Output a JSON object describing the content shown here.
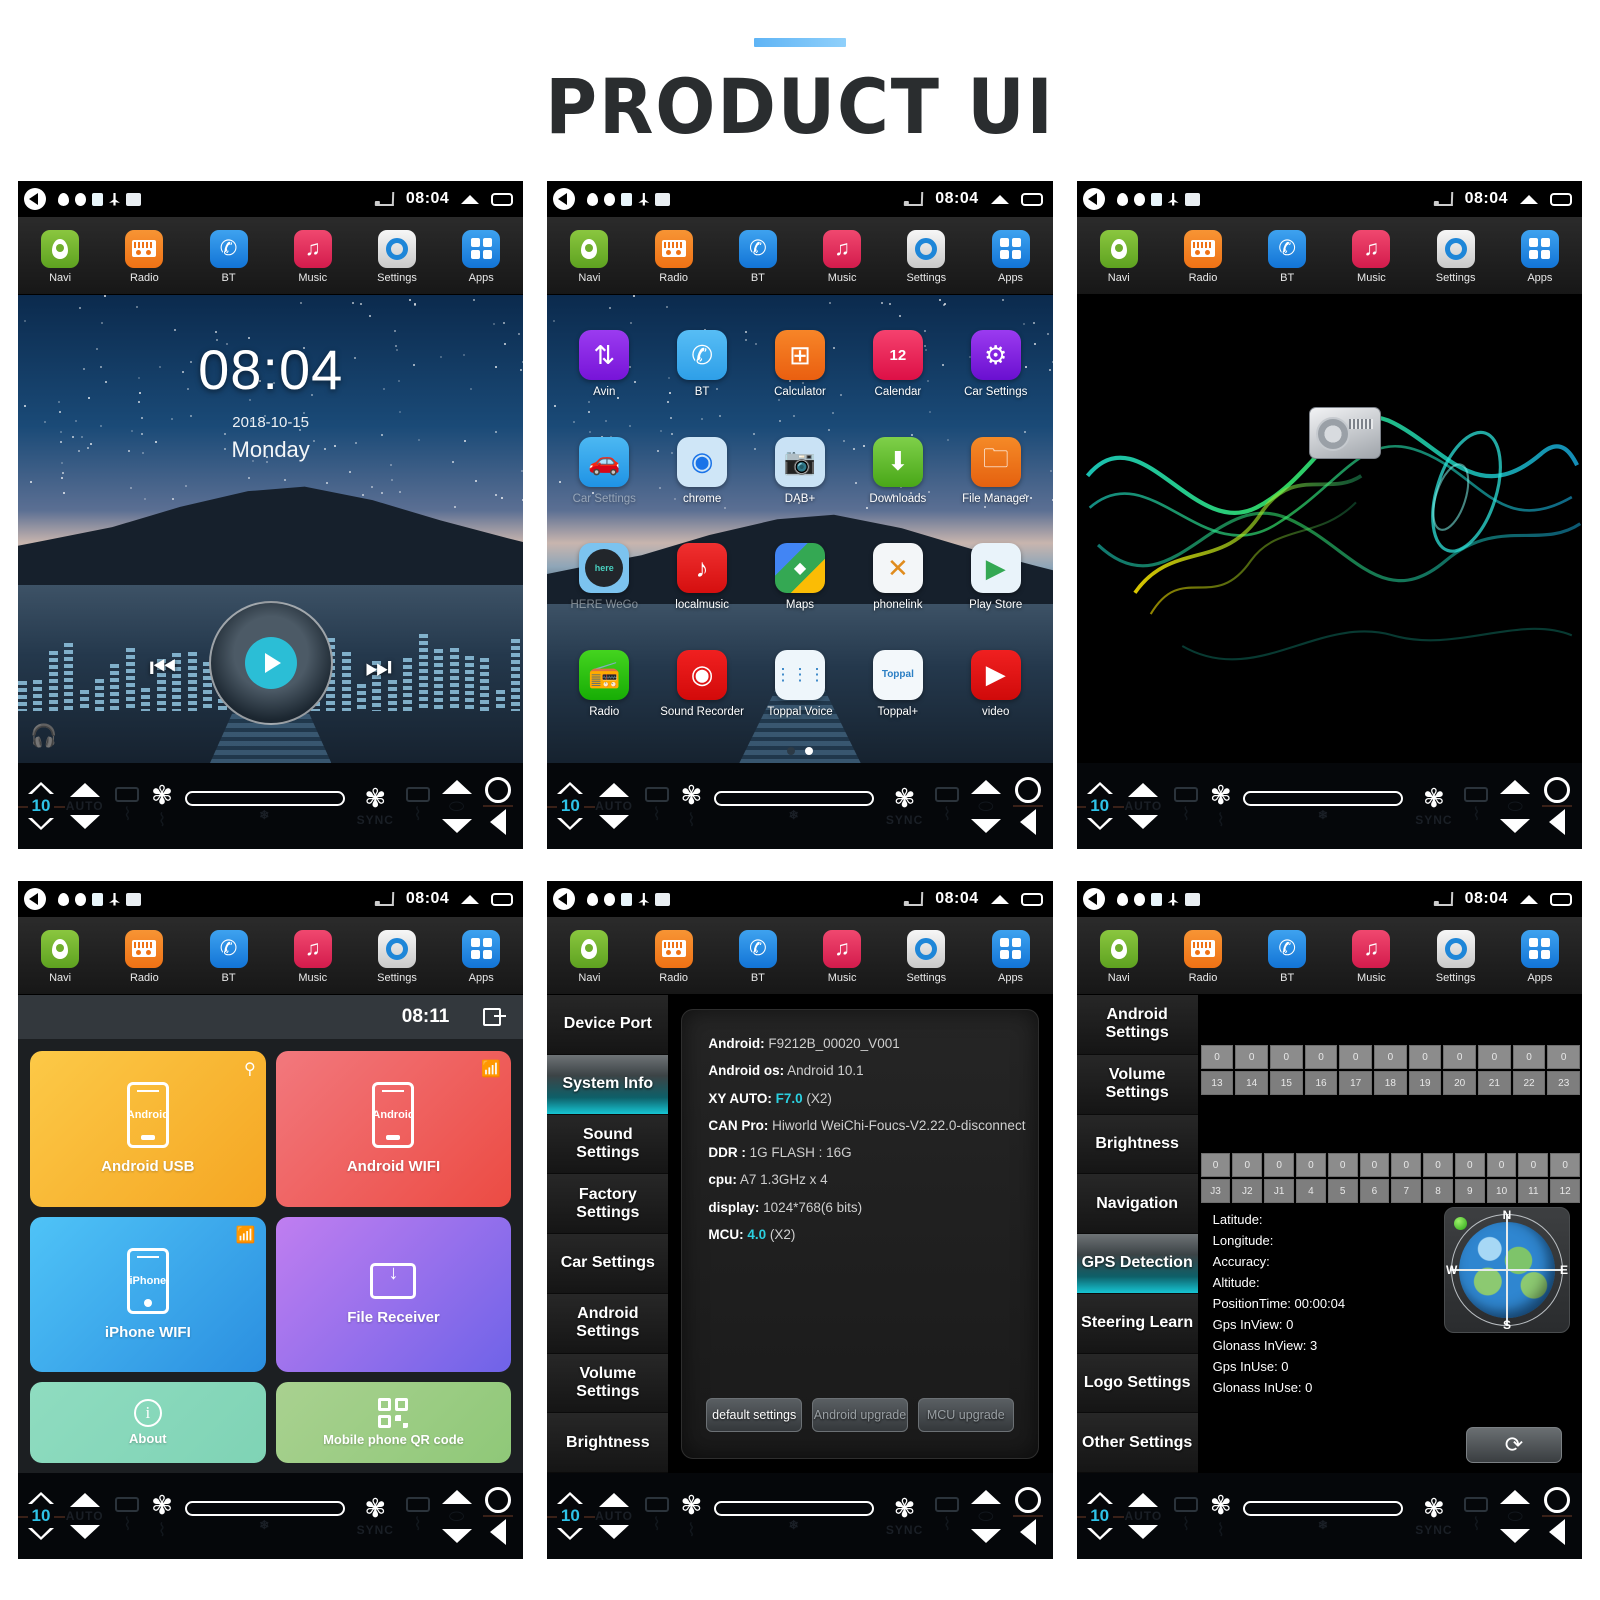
{
  "header": {
    "title": "PRODUCT UI",
    "accent_color": "#5fb4f5"
  },
  "statusbar": {
    "time": "08:04",
    "icons": [
      "back-icon",
      "location-pin-icon",
      "droplet-icon",
      "badge-icon",
      "bluetooth-icon",
      "card-icon",
      "cast-icon",
      "chevron-up-icon",
      "window-icon"
    ]
  },
  "navbar": {
    "items": [
      {
        "label": "Navi",
        "icon": "location-pin-icon",
        "color": "#6fae2c"
      },
      {
        "label": "Radio",
        "icon": "radio-icon",
        "color": "#ef7215"
      },
      {
        "label": "BT",
        "icon": "phone-icon",
        "color": "#1274d6"
      },
      {
        "label": "Music",
        "icon": "music-note-icon",
        "color": "#d31b4c"
      },
      {
        "label": "Settings",
        "icon": "gear-icon",
        "color": "#e6e6e6"
      },
      {
        "label": "Apps",
        "icon": "grid-icon",
        "color": "#1274d6"
      }
    ]
  },
  "home": {
    "clock": "08:04",
    "date": "2018-10-15",
    "weekday": "Monday",
    "prev_icon": "rewind-icon",
    "next_icon": "fast-forward-icon",
    "play_icon": "play-icon",
    "headphone_icon": "headphone-icon"
  },
  "apps": {
    "items": [
      {
        "label": "Avin",
        "dim": false
      },
      {
        "label": "BT",
        "dim": false
      },
      {
        "label": "Calculator",
        "dim": false
      },
      {
        "label": "Calendar",
        "dim": false
      },
      {
        "label": "Car Settings",
        "dim": false
      },
      {
        "label": "Car Settings",
        "dim": true
      },
      {
        "label": "chrome",
        "dim": false
      },
      {
        "label": "DAB+",
        "dim": false
      },
      {
        "label": "Downloads",
        "dim": false
      },
      {
        "label": "File Manager",
        "dim": false
      },
      {
        "label": "HERE WeGo",
        "dim": true
      },
      {
        "label": "localmusic",
        "dim": false
      },
      {
        "label": "Maps",
        "dim": false
      },
      {
        "label": "phonelink",
        "dim": false
      },
      {
        "label": "Play Store",
        "dim": false
      },
      {
        "label": "Radio",
        "dim": false
      },
      {
        "label": "Sound Recorder",
        "dim": false
      },
      {
        "label": "Toppal Voice",
        "dim": false
      },
      {
        "label": "Toppal+",
        "dim": false
      },
      {
        "label": "video",
        "dim": false
      }
    ],
    "page_current": 2,
    "page_total": 2
  },
  "visualizer": {
    "device_icon": "radio-device-icon"
  },
  "hvac": {
    "temp_left": "10",
    "auto_label": "AUTO",
    "sync_label": "SYNC",
    "fan_icon": "fan-icon",
    "defrost_icon": "defrost-icon",
    "rear_defrost_icon": "rear-defrost-icon",
    "power_icon": "power-icon",
    "back_icon": "back-triangle-icon"
  },
  "phonelink": {
    "time": "08:11",
    "exit_icon": "exit-icon",
    "tiles": [
      {
        "label": "Android USB",
        "device": "Android",
        "corner_icon": "usb-icon"
      },
      {
        "label": "Android WIFI",
        "device": "Android",
        "corner_icon": "wifi-icon"
      },
      {
        "label": "iPhone WIFI",
        "device": "iPhone",
        "corner_icon": "wifi-icon"
      },
      {
        "label": "File Receiver",
        "device": "",
        "corner_icon": ""
      },
      {
        "label": "About",
        "device": "",
        "corner_icon": "info-icon"
      },
      {
        "label": "Mobile phone QR code",
        "device": "",
        "corner_icon": "qr-icon"
      }
    ]
  },
  "settings_system": {
    "sidebar": [
      {
        "label": "Device Port",
        "active": false
      },
      {
        "label": "System Info",
        "active": true
      },
      {
        "label": "Sound Settings",
        "active": false
      },
      {
        "label": "Factory Settings",
        "active": false
      },
      {
        "label": "Car Settings",
        "active": false
      },
      {
        "label": "Android Settings",
        "active": false
      },
      {
        "label": "Volume Settings",
        "active": false
      },
      {
        "label": "Brightness",
        "active": false
      }
    ],
    "info": [
      {
        "key": "Android:",
        "value": "F9212B_00020_V001",
        "highlight": ""
      },
      {
        "key": "Android os:",
        "value": "Android 10.1",
        "highlight": ""
      },
      {
        "key": "XY AUTO:",
        "value": "(X2)",
        "highlight": "F7.0"
      },
      {
        "key": "CAN Pro:",
        "value": "Hiworld WeiChi-Foucs-V2.22.0-disconnect",
        "highlight": ""
      },
      {
        "key": "DDR :",
        "value": "1G        FLASH :  16G",
        "highlight": ""
      },
      {
        "key": "cpu:",
        "value": "A7 1.3GHz x 4",
        "highlight": ""
      },
      {
        "key": "display:",
        "value": "1024*768(6 bits)",
        "highlight": ""
      },
      {
        "key": "MCU:",
        "value": "(X2)",
        "highlight": "4.0"
      }
    ],
    "buttons": [
      {
        "label": "default settings",
        "dim": false
      },
      {
        "label": "Android upgrade",
        "dim": true
      },
      {
        "label": "MCU upgrade",
        "dim": true
      }
    ]
  },
  "settings_gps": {
    "sidebar": [
      {
        "label": "Android Settings",
        "active": false
      },
      {
        "label": "Volume Settings",
        "active": false
      },
      {
        "label": "Brightness",
        "active": false
      },
      {
        "label": "Navigation",
        "active": false
      },
      {
        "label": "GPS Detection",
        "active": true
      },
      {
        "label": "Steering Learn",
        "active": false
      },
      {
        "label": "Logo Settings",
        "active": false
      },
      {
        "label": "Other Settings",
        "active": false
      }
    ],
    "sat_block_1": {
      "values": [
        "0",
        "0",
        "0",
        "0",
        "0",
        "0",
        "0",
        "0",
        "0",
        "0",
        "0"
      ],
      "labels": [
        "13",
        "14",
        "15",
        "16",
        "17",
        "18",
        "19",
        "20",
        "21",
        "22",
        "23"
      ]
    },
    "sat_block_2": {
      "values": [
        "0",
        "0",
        "0",
        "0",
        "0",
        "0",
        "0",
        "0",
        "0",
        "0",
        "0",
        "0"
      ],
      "labels": [
        "J3",
        "J2",
        "J1",
        "4",
        "5",
        "6",
        "7",
        "8",
        "9",
        "10",
        "11",
        "12"
      ]
    },
    "readouts": [
      "Latitude:",
      "Longitude:",
      "Accuracy:",
      "Altitude:",
      "PositionTime: 00:00:04",
      "Gps InView: 0",
      "Glonass InView: 3",
      "Gps InUse: 0",
      "Glonass InUse: 0"
    ],
    "compass": {
      "n": "N",
      "s": "S",
      "e": "E",
      "w": "W"
    },
    "refresh_icon": "refresh-icon"
  }
}
